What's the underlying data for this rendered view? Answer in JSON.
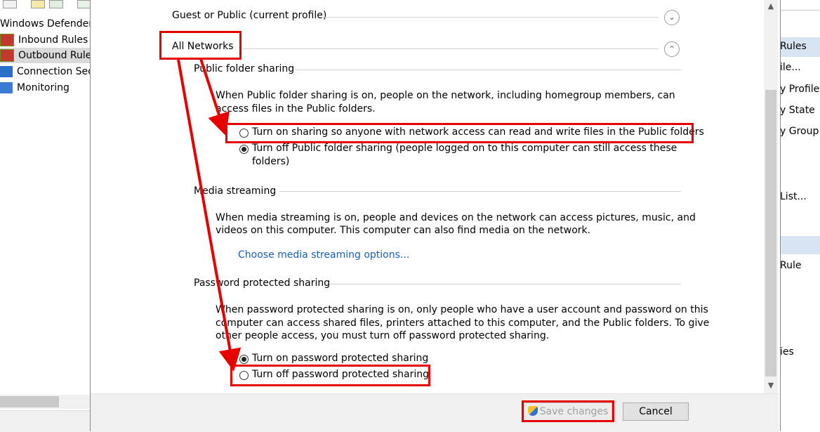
{
  "left_tree": {
    "items": [
      {
        "label": "Windows Defender",
        "icon": "firewall-icon"
      },
      {
        "label": "Inbound Rules",
        "icon": "inbound-rules-icon"
      },
      {
        "label": "Outbound Rules",
        "icon": "outbound-rules-icon"
      },
      {
        "label": "Connection Sec",
        "icon": "connection-security-icon"
      },
      {
        "label": "Monitoring",
        "icon": "monitoring-icon"
      }
    ]
  },
  "right_actions": {
    "items": [
      "Rules",
      "ile...",
      "y Profile",
      "y State",
      "y Group",
      "List...",
      "Rule",
      "ies"
    ]
  },
  "dialog": {
    "guest_public": "Guest or Public (current profile)",
    "all_networks": "All Networks",
    "public_folder": {
      "title": "Public folder sharing",
      "desc_1": "When Public folder sharing is on, people on the network, including homegroup members, can",
      "desc_2": "access files in the Public folders.",
      "opt_on": "Turn on sharing so anyone with network access can read and write files in the Public folders",
      "opt_off_1": "Turn off Public folder sharing (people logged on to this computer can still access these",
      "opt_off_2": "folders)"
    },
    "media": {
      "title": "Media streaming",
      "desc_1": "When media streaming is on, people and devices on the network can access pictures, music, and",
      "desc_2": "videos on this computer. This computer can also find media on the network.",
      "link": "Choose media streaming options..."
    },
    "password": {
      "title": "Password protected sharing",
      "desc_1": "When password protected sharing is on, only people who have a user account and password on this",
      "desc_2": "computer can access shared files, printers attached to this computer, and the Public folders. To give",
      "desc_3": "other people access, you must turn off password protected sharing.",
      "opt_on": "Turn on password protected sharing",
      "opt_off": "Turn off password protected sharing"
    },
    "buttons": {
      "save": "Save changes",
      "cancel": "Cancel"
    }
  },
  "colors": {
    "highlight": "#e60000",
    "link": "#1a5fb4"
  }
}
